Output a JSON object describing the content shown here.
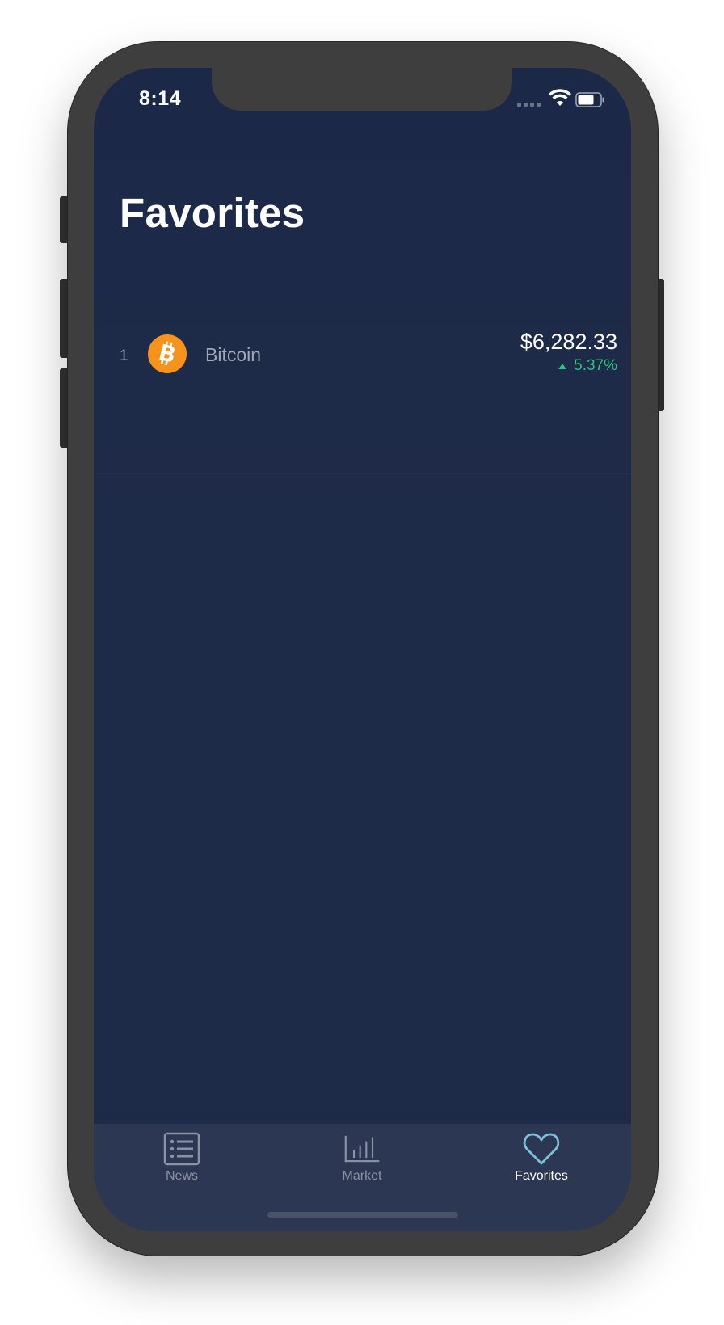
{
  "status_bar": {
    "time": "8:14"
  },
  "page": {
    "title": "Favorites"
  },
  "favorites": [
    {
      "rank": "1",
      "name": "Bitcoin",
      "icon": "bitcoin-icon",
      "price": "$6,282.33",
      "change": "5.37%",
      "change_direction": "up"
    }
  ],
  "tab_bar": {
    "items": [
      {
        "label": "News",
        "icon": "news-list-icon",
        "active": false
      },
      {
        "label": "Market",
        "icon": "bar-chart-icon",
        "active": false
      },
      {
        "label": "Favorites",
        "icon": "heart-icon",
        "active": true
      }
    ]
  },
  "colors": {
    "background": "#1e2b48",
    "tab_bar": "#2b3753",
    "positive_change": "#2ec27e",
    "bitcoin_orange": "#f7931a",
    "active_tab_icon": "#7fbfd8"
  }
}
